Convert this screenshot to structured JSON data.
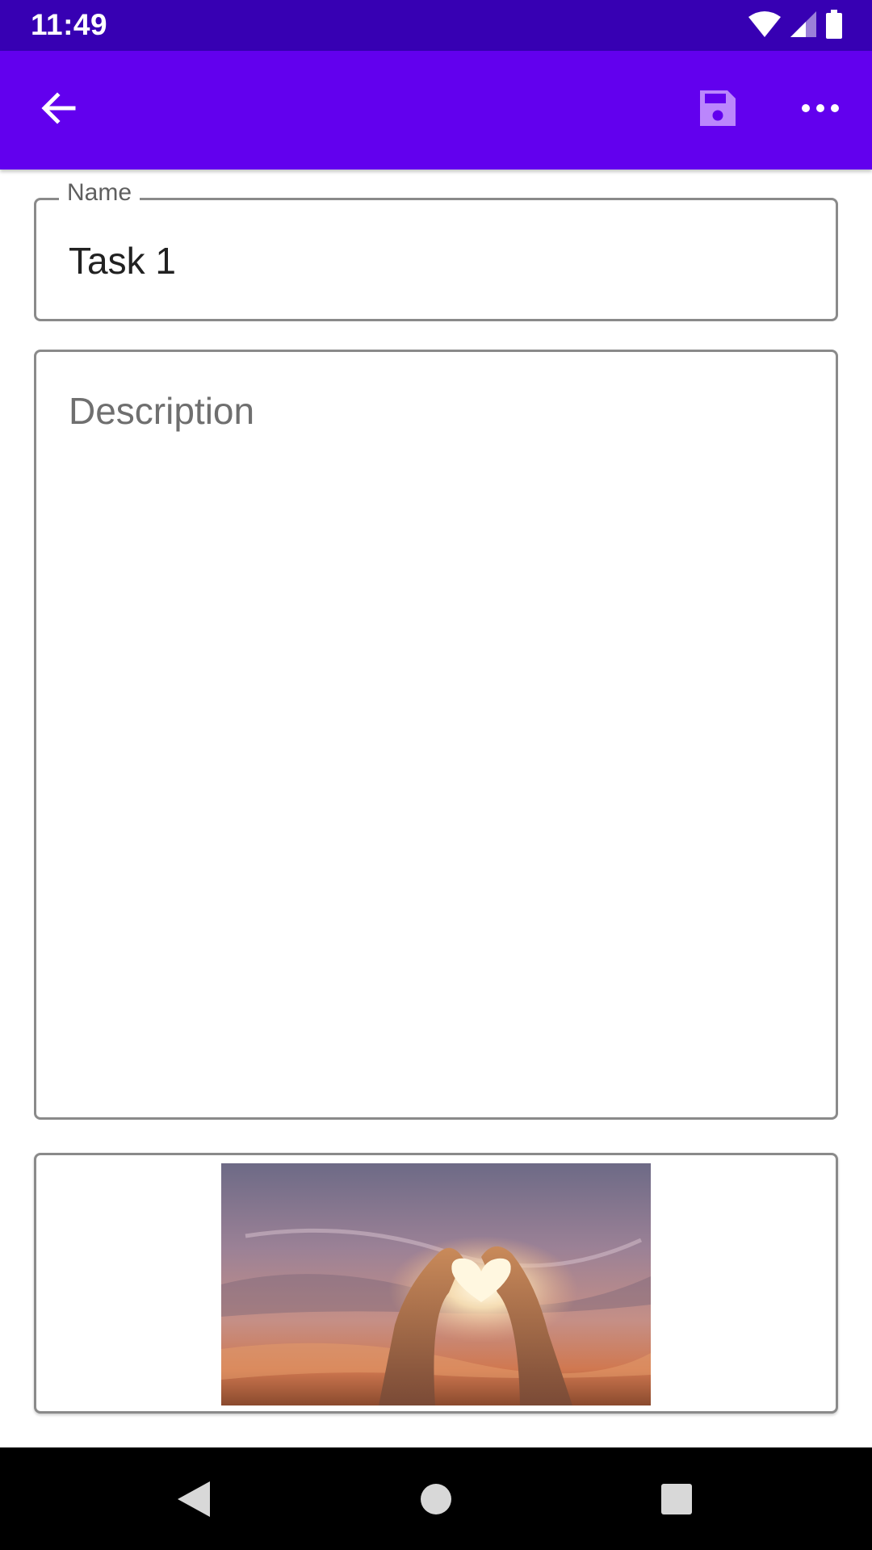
{
  "status_bar": {
    "time": "11:49",
    "icons": [
      "wifi-icon",
      "signal-icon",
      "battery-icon"
    ]
  },
  "app_bar": {
    "back_icon": "arrow-back-icon",
    "save_icon": "save-icon",
    "more_icon": "more-horizontal-icon",
    "background": "#6200ee",
    "status_background": "#3700b3",
    "save_icon_color": "#bb86fc"
  },
  "form": {
    "name_label": "Name",
    "name_value": "Task 1",
    "description_placeholder": "Description"
  },
  "image_attachment": {
    "icon": "heart-hands-sunset-photo"
  },
  "nav_bar": {
    "icons": [
      "nav-back-icon",
      "nav-home-icon",
      "nav-recents-icon"
    ]
  }
}
